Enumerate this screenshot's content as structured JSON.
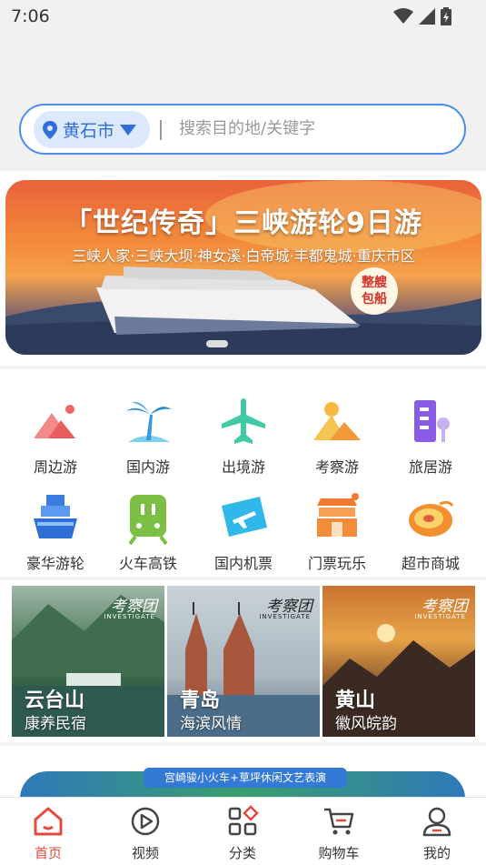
{
  "status": {
    "time": "7:06"
  },
  "search": {
    "city": "黄石市",
    "placeholder": "搜索目的地/关键字"
  },
  "banner": {
    "title": "「世纪传奇」三峡游轮9日游",
    "subtitle": "三峡人家·三峡大坝·神女溪·白帝城·丰都鬼城·重庆市区",
    "badge_line1": "整艘",
    "badge_line2": "包船"
  },
  "categories": [
    {
      "label": "周边游",
      "icon": "mountain-icon"
    },
    {
      "label": "国内游",
      "icon": "palm-tree-icon"
    },
    {
      "label": "出境游",
      "icon": "airplane-icon"
    },
    {
      "label": "考察游",
      "icon": "sun-mountain-icon"
    },
    {
      "label": "旅居游",
      "icon": "building-icon"
    },
    {
      "label": "豪华游轮",
      "icon": "cruise-ship-icon"
    },
    {
      "label": "火车高铁",
      "icon": "train-icon"
    },
    {
      "label": "国内机票",
      "icon": "flight-ticket-icon"
    },
    {
      "label": "门票玩乐",
      "icon": "gate-icon"
    },
    {
      "label": "超市商城",
      "icon": "fruit-icon"
    }
  ],
  "cards": [
    {
      "tag": "考察团",
      "tag_en": "INVESTIGATE",
      "title": "云台山",
      "subtitle": "康养民宿"
    },
    {
      "tag": "考察团",
      "tag_en": "INVESTIGATE",
      "title": "青岛",
      "subtitle": "海滨风情"
    },
    {
      "tag": "考察团",
      "tag_en": "INVESTIGATE",
      "title": "黄山",
      "subtitle": "徽风皖韵"
    }
  ],
  "promo": {
    "ribbon": "宫崎骏小火车+草坪休闲文艺表演"
  },
  "tabs": [
    {
      "label": "首页",
      "icon": "home-icon",
      "active": true
    },
    {
      "label": "视频",
      "icon": "play-icon"
    },
    {
      "label": "分类",
      "icon": "category-icon"
    },
    {
      "label": "购物车",
      "icon": "cart-icon"
    },
    {
      "label": "我的",
      "icon": "user-icon"
    }
  ],
  "colors": {
    "accent": "#4a8ef0",
    "active_tab": "#e34b3d"
  }
}
